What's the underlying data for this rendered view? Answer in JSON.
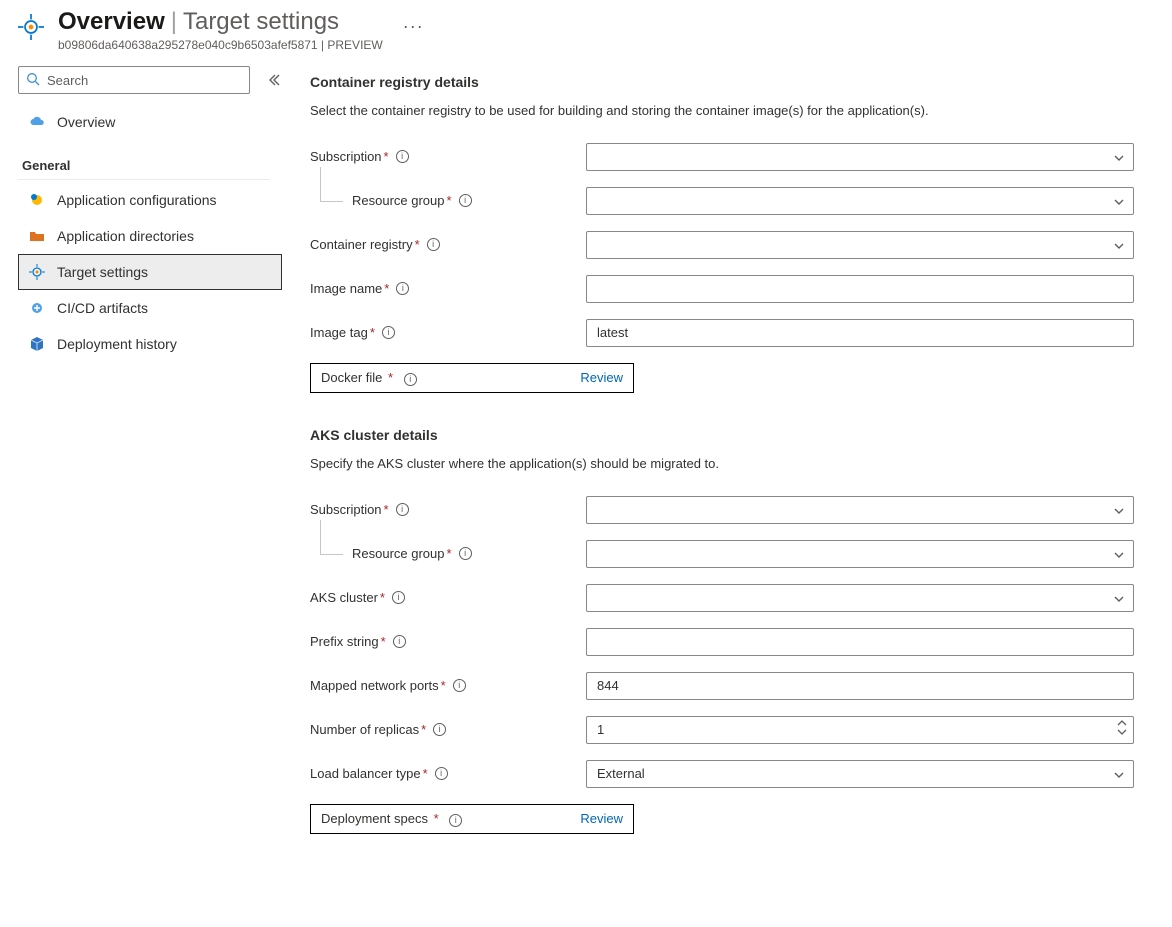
{
  "header": {
    "title_main": "Overview",
    "title_sub": "Target settings",
    "id_line": "b09806da640638a295278e040c9b6503afef5871 | PREVIEW"
  },
  "sidebar": {
    "search_placeholder": "Search",
    "top_item": {
      "label": "Overview"
    },
    "section_title": "General",
    "items": [
      {
        "label": "Application configurations"
      },
      {
        "label": "Application directories"
      },
      {
        "label": "Target settings",
        "selected": true
      },
      {
        "label": "CI/CD artifacts"
      },
      {
        "label": "Deployment history"
      }
    ]
  },
  "section1": {
    "heading": "Container registry details",
    "desc": "Select the container registry to be used for building and storing the container image(s) for the application(s).",
    "fields": {
      "subscription": "Subscription",
      "resource_group": "Resource group",
      "container_registry": "Container registry",
      "image_name": "Image name",
      "image_tag": "Image tag",
      "image_tag_value": "latest",
      "docker_file": "Docker file",
      "review": "Review"
    }
  },
  "section2": {
    "heading": "AKS cluster details",
    "desc": "Specify the AKS cluster where the application(s) should be migrated to.",
    "fields": {
      "subscription": "Subscription",
      "resource_group": "Resource group",
      "aks_cluster": "AKS cluster",
      "prefix_string": "Prefix string",
      "mapped_ports": "Mapped network ports",
      "mapped_ports_value": "844",
      "replicas": "Number of replicas",
      "replicas_value": "1",
      "lb_type": "Load balancer type",
      "lb_type_value": "External",
      "deploy_specs": "Deployment specs",
      "review": "Review"
    }
  }
}
